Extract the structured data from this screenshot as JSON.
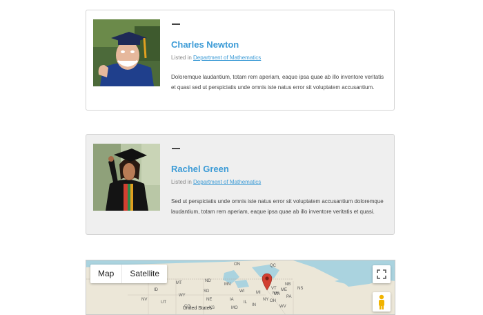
{
  "profiles": [
    {
      "name": "Charles Newton",
      "listed_prefix": "Listed in",
      "department": "Department of Mathematics",
      "description": "Doloremque laudantium, totam rem aperiam, eaque ipsa quae ab illo inventore veritatis et quasi sed ut perspiciatis unde omnis iste natus error sit voluptatem accusantium."
    },
    {
      "name": "Rachel Green",
      "listed_prefix": "Listed in",
      "department": "Department of Mathematics",
      "description": "Sed ut perspiciatis unde omnis iste natus error sit voluptatem accusantium doloremque laudantium, totam rem aperiam, eaque ipsa quae ab illo inventore veritatis et quasi."
    }
  ],
  "map": {
    "type_buttons": [
      "Map",
      "Satellite"
    ],
    "labels": {
      "on": "ON",
      "qc": "QC",
      "mt": "MT",
      "nd": "ND",
      "mn": "MN",
      "wi": "WI",
      "mi": "MI",
      "id": "ID",
      "wy": "WY",
      "sd": "SD",
      "nv": "NV",
      "ut": "UT",
      "ne": "NE",
      "ia": "IA",
      "il": "IL",
      "oh": "OH",
      "pa": "PA",
      "ny": "NY",
      "vt": "VT",
      "me": "ME",
      "nb": "NB",
      "ns": "NS",
      "ma": "MA",
      "nh": "NH",
      "co": "CO",
      "ks": "KS",
      "mo": "MO",
      "in": "IN",
      "wv": "WV",
      "us": "United States"
    },
    "colors": {
      "water": "#aad3df",
      "land": "#e8e4d8",
      "pin": "#d23f31"
    }
  }
}
